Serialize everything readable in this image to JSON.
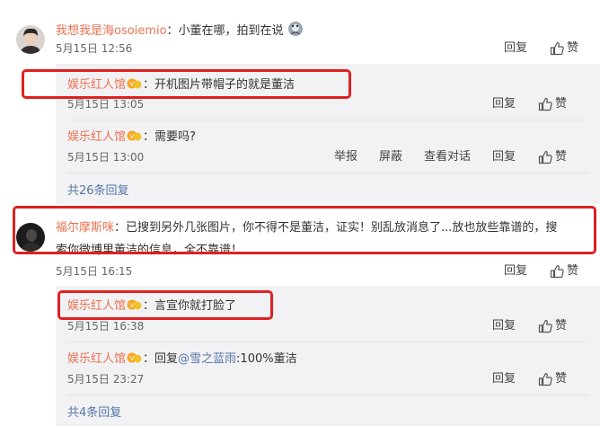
{
  "comments": [
    {
      "name": "我想我是海osoiemio",
      "text": "：小董在哪，拍到在说",
      "time": "5月15日 12:56",
      "reply_label": "回复",
      "like_label": "赞",
      "replies": [
        {
          "name": "娱乐红人馆",
          "text": "：开机图片带帽子的就是董洁",
          "time": "5月15日 13:05",
          "reply_label": "回复",
          "like_label": "赞"
        },
        {
          "name": "娱乐红人馆",
          "text": "：需要吗?",
          "time": "5月15日 13:00",
          "report_label": "举报",
          "block_label": "屏蔽",
          "view_label": "查看对话",
          "reply_label": "回复",
          "like_label": "赞"
        }
      ],
      "more": "共26条回复"
    },
    {
      "name": "福尔摩斯咪",
      "text_line1": "：已搜到另外几张图片，你不得不是董洁，证实！别乱放消息了...放也放些靠谱的，搜",
      "text_line2": "索你微博里董洁的信息，全不靠谱！",
      "time": "5月15日 16:15",
      "reply_label": "回复",
      "like_label": "赞",
      "replies": [
        {
          "name": "娱乐红人馆",
          "text": "：言宣你就打脸了",
          "time": "5月15日 16:38",
          "reply_label": "回复",
          "like_label": "赞"
        },
        {
          "name": "娱乐红人馆",
          "prefix": "：回复",
          "mention": "@雪之蓝雨",
          "text": ":100%董洁",
          "time": "5月15日 23:27",
          "reply_label": "回复",
          "like_label": "赞"
        }
      ],
      "more": "共4条回复"
    }
  ],
  "colors": {
    "name": "#eb7350",
    "link": "#5677a8",
    "highlight": "#e02020",
    "reply_bg": "#f2f2f5"
  },
  "icons": [
    "thumbs-up-icon",
    "verified-badge-icon",
    "emoji-icon"
  ]
}
